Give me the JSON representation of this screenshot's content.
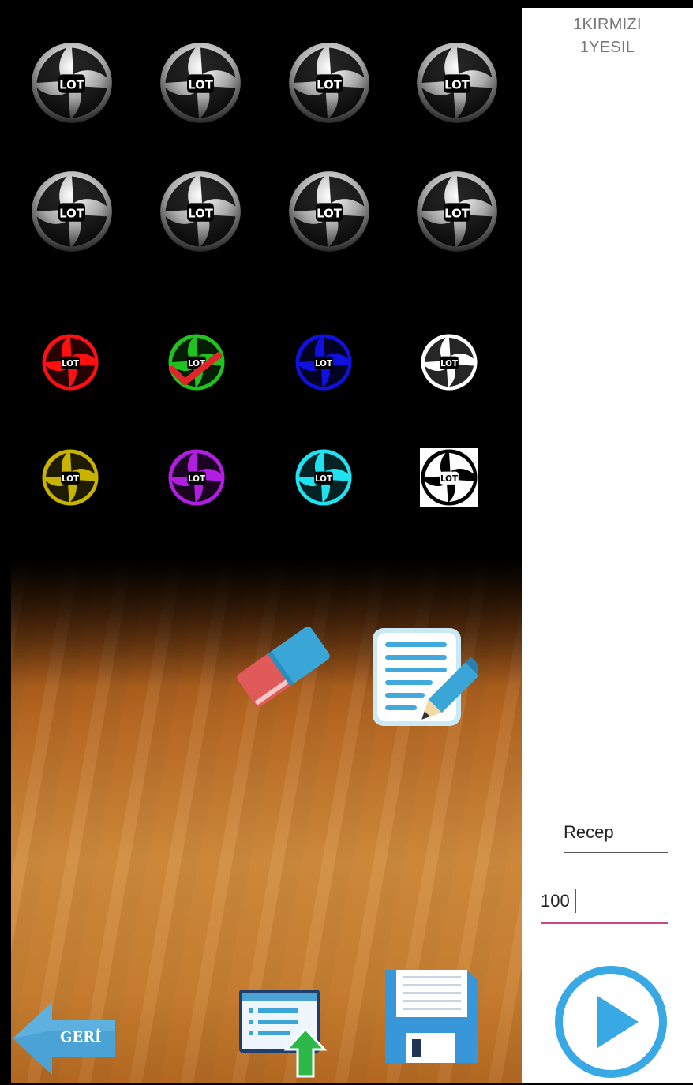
{
  "panel": {
    "result_lines": [
      "1KIRMIZI",
      "1YESIL"
    ],
    "name_value": "Recep",
    "amount_value": "100"
  },
  "back_button": {
    "label": "GERİ"
  },
  "lens_rows": {
    "row1": [
      "gray",
      "gray",
      "gray",
      "gray"
    ],
    "row2": [
      "gray",
      "gray",
      "gray",
      "gray"
    ],
    "row3": [
      "red",
      "green",
      "blue",
      "white"
    ],
    "row4": [
      "yellow",
      "purple",
      "cyan",
      "black"
    ]
  },
  "lens_logo_text": "LOT",
  "selected_lens": "green",
  "colors": {
    "red": "#ff1010",
    "green": "#1fc21f",
    "blue": "#1010e0",
    "white": "#ffffff",
    "yellow": "#c8b400",
    "purple": "#b01ee0",
    "cyan": "#1ee2f0",
    "black": "#000000",
    "accent_pink": "#c3478a",
    "play_blue": "#39a9e6"
  }
}
